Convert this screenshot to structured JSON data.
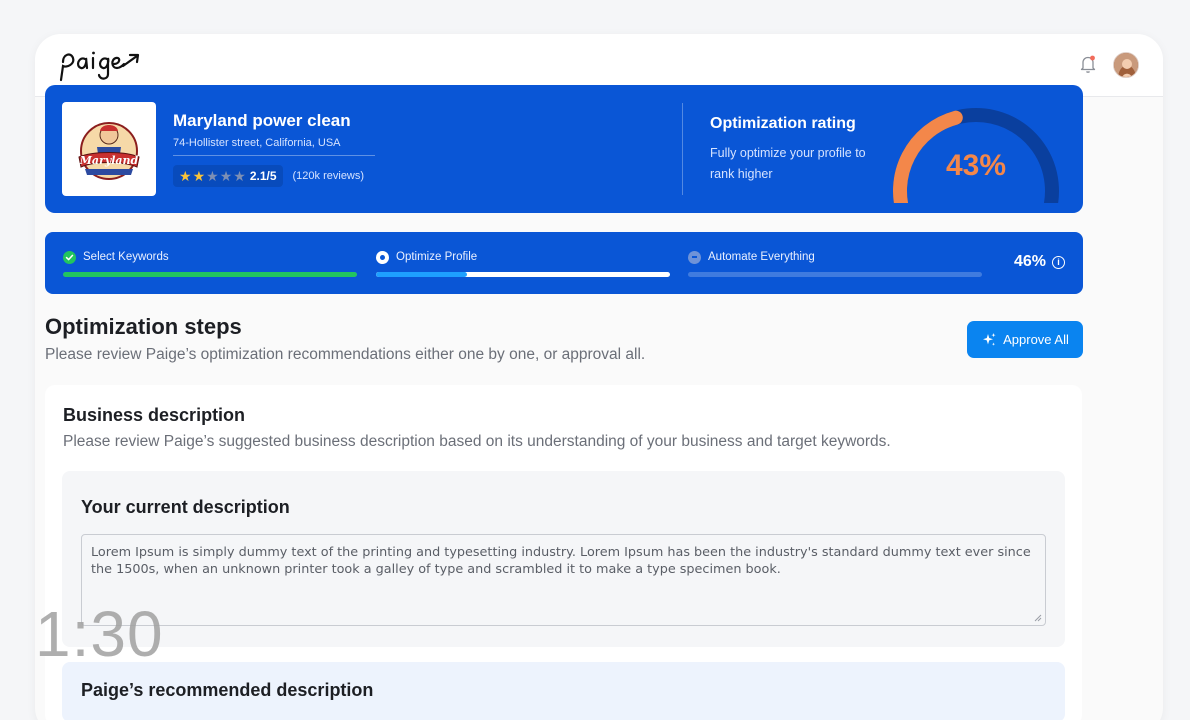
{
  "app": {
    "logo_text": "paige"
  },
  "business": {
    "name": "Maryland power clean",
    "address": "74-Hollister street, California, USA",
    "rating_value": 2.1,
    "rating_text": "2.1/5",
    "stars_filled": 2,
    "stars_total": 5,
    "reviews": "(120k reviews)",
    "logo_text": "Maryland"
  },
  "optimization": {
    "title": "Optimization rating",
    "subtitle": "Fully optimize your profile to rank higher",
    "percent": 43,
    "percent_text": "43%",
    "gauge_color": "#f3874a"
  },
  "progress": {
    "steps": [
      {
        "label": "Select Keywords",
        "status": "complete",
        "progress": 1.0,
        "color": "#22c55e"
      },
      {
        "label": "Optimize Profile",
        "status": "active",
        "progress": 0.31,
        "color": "#1ea0ff"
      },
      {
        "label": "Automate Everything",
        "status": "pending",
        "progress": 0,
        "color": "#6f93d8"
      }
    ],
    "total_text": "46%"
  },
  "steps_section": {
    "title": "Optimization steps",
    "subtitle": "Please review Paige’s optimization recommendations either one by one, or approval all.",
    "approve_label": "Approve All"
  },
  "business_description": {
    "title": "Business description",
    "subtitle": "Please review Paige’s suggested business description based on its understanding of your business and target keywords.",
    "current_title": "Your current description",
    "current_text": "Lorem Ipsum is simply dummy text of the printing and typesetting industry. Lorem Ipsum has been the industry's standard dummy text ever since the 1500s, when an unknown printer took a galley of type and scrambled it to make a type specimen book.",
    "next_title": "Paige’s recommended description"
  },
  "overlay": {
    "timer": "1:30"
  }
}
